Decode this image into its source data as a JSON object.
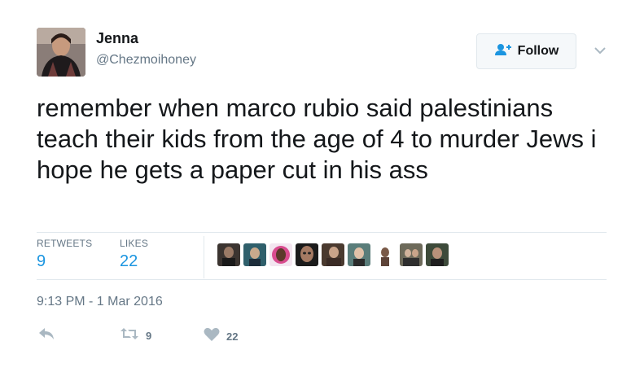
{
  "user": {
    "name": "Jenna",
    "handle": "@Chezmoihoney"
  },
  "follow": {
    "label": "Follow"
  },
  "tweet": {
    "text": "remember when marco rubio said palestinians teach their kids from the age of 4 to murder Jews i hope he gets a paper cut in his ass",
    "timestamp": "9:13 PM - 1 Mar 2016"
  },
  "stats": {
    "retweets_label": "RETWEETS",
    "retweets_value": "9",
    "likes_label": "LIKES",
    "likes_value": "22"
  },
  "actions": {
    "retweet_count": "9",
    "like_count": "22"
  },
  "colors": {
    "link": "#1b95e0",
    "secondary": "#657786",
    "border": "#e1e8ed"
  },
  "icons": [
    "add-user-icon",
    "chevron-down-icon",
    "reply-icon",
    "retweet-icon",
    "heart-icon"
  ]
}
